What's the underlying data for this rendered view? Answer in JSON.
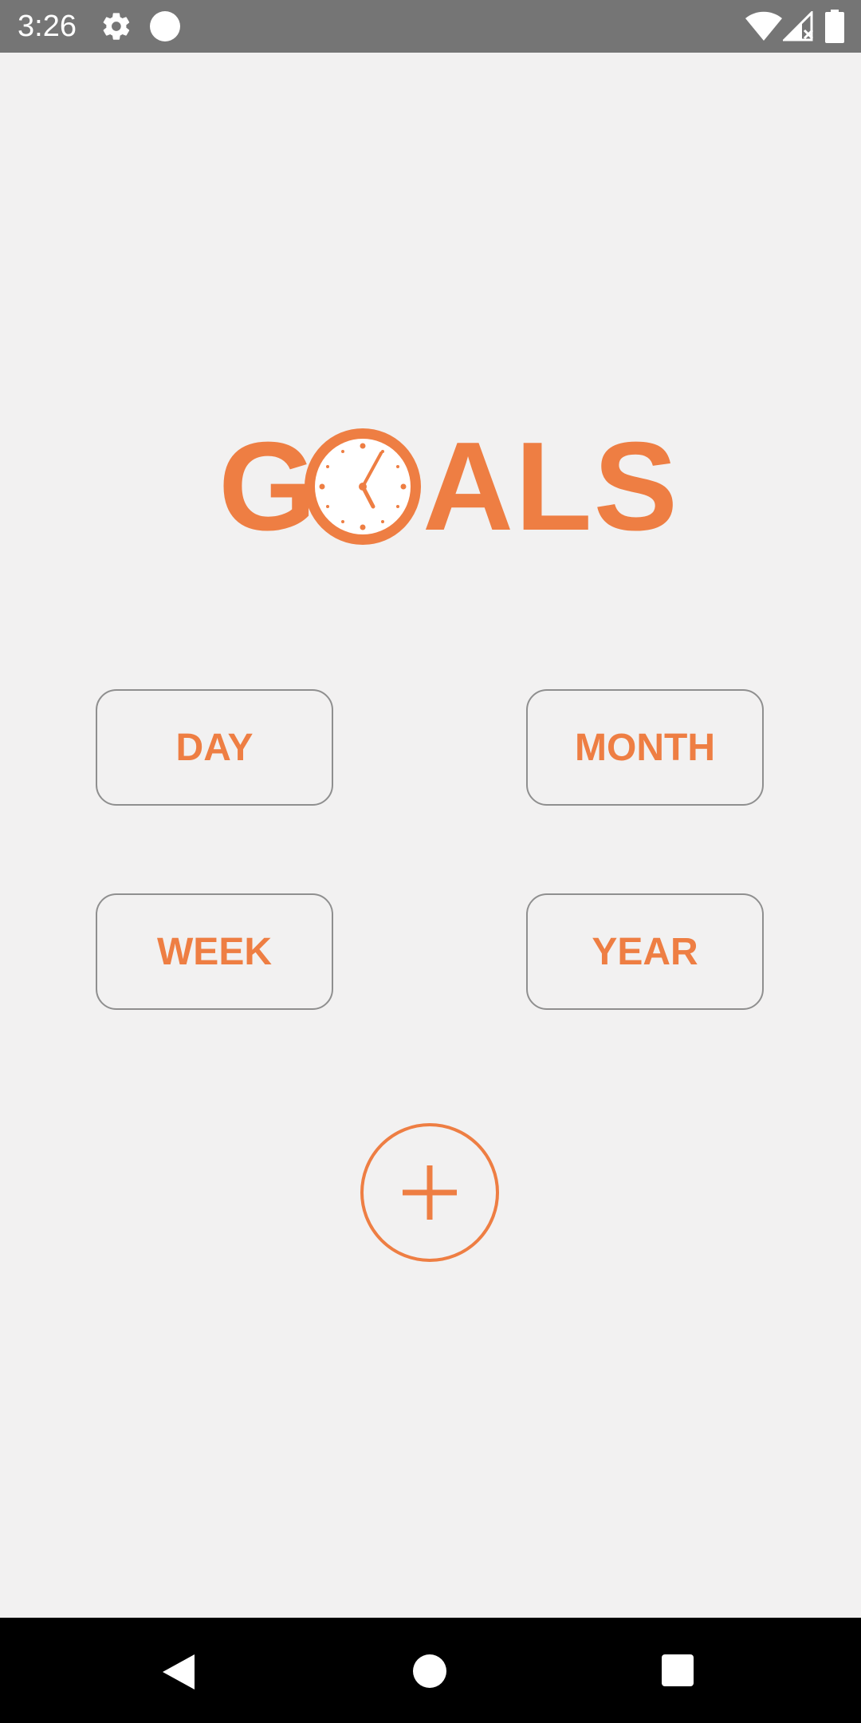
{
  "status_bar": {
    "time": "3:26",
    "icons": [
      "gear-icon",
      "circle-notification-icon",
      "wifi-icon",
      "signal-icon",
      "battery-icon"
    ]
  },
  "logo": {
    "text_first": "G",
    "text_rest": "ALS",
    "icon": "clock-icon",
    "color": "#ee7e43"
  },
  "buttons": {
    "day": "DAY",
    "month": "MONTH",
    "week": "WEEK",
    "year": "YEAR"
  },
  "add_button": {
    "icon": "plus-icon"
  },
  "nav_bar": {
    "icons": [
      "back-icon",
      "home-icon",
      "recents-icon"
    ]
  },
  "colors": {
    "accent": "#ee7e43",
    "background": "#f2f1f1",
    "status_bar": "#757575",
    "button_border": "#8f8f8f"
  }
}
